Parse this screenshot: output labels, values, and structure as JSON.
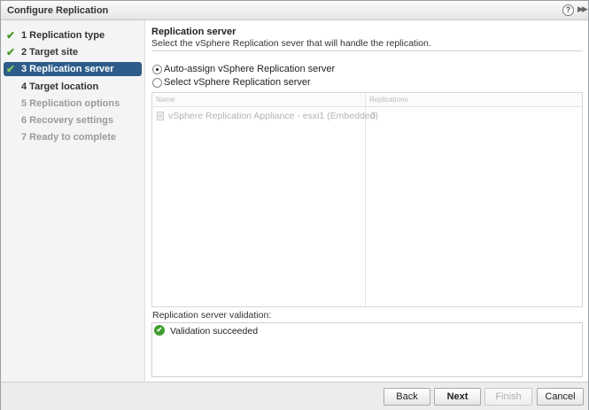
{
  "window": {
    "title": "Configure Replication",
    "help_glyph": "?",
    "expand_glyph": "▶▶"
  },
  "steps": [
    {
      "label": "1 Replication type",
      "state": "done"
    },
    {
      "label": "2 Target site",
      "state": "done"
    },
    {
      "label": "3 Replication server",
      "state": "active"
    },
    {
      "label": "4 Target location",
      "state": "current-next"
    },
    {
      "label": "5 Replication options",
      "state": "pending"
    },
    {
      "label": "6 Recovery settings",
      "state": "pending"
    },
    {
      "label": "7 Ready to complete",
      "state": "pending"
    }
  ],
  "check_glyph": "✔",
  "main": {
    "title": "Replication server",
    "description": "Select the vSphere Replication sever that will handle the replication.",
    "options": [
      {
        "label": "Auto-assign vSphere Replication server",
        "selected": true
      },
      {
        "label": "Select vSphere Replication server",
        "selected": false
      }
    ],
    "table": {
      "columns": [
        "Name",
        "Replications"
      ],
      "rows": [
        {
          "name": "vSphere Replication Appliance - esxi1 (Embedded)",
          "replications": "0"
        }
      ]
    },
    "validation": {
      "label": "Replication server validation:",
      "message": "Validation succeeded",
      "icon_glyph": "✔"
    }
  },
  "footer": {
    "back": "Back",
    "next": "Next",
    "finish": "Finish",
    "cancel": "Cancel"
  },
  "colors": {
    "active_step_bg": "#2d5c8a",
    "check_green": "#4a9a2e",
    "validation_green": "#3f9e2f"
  }
}
